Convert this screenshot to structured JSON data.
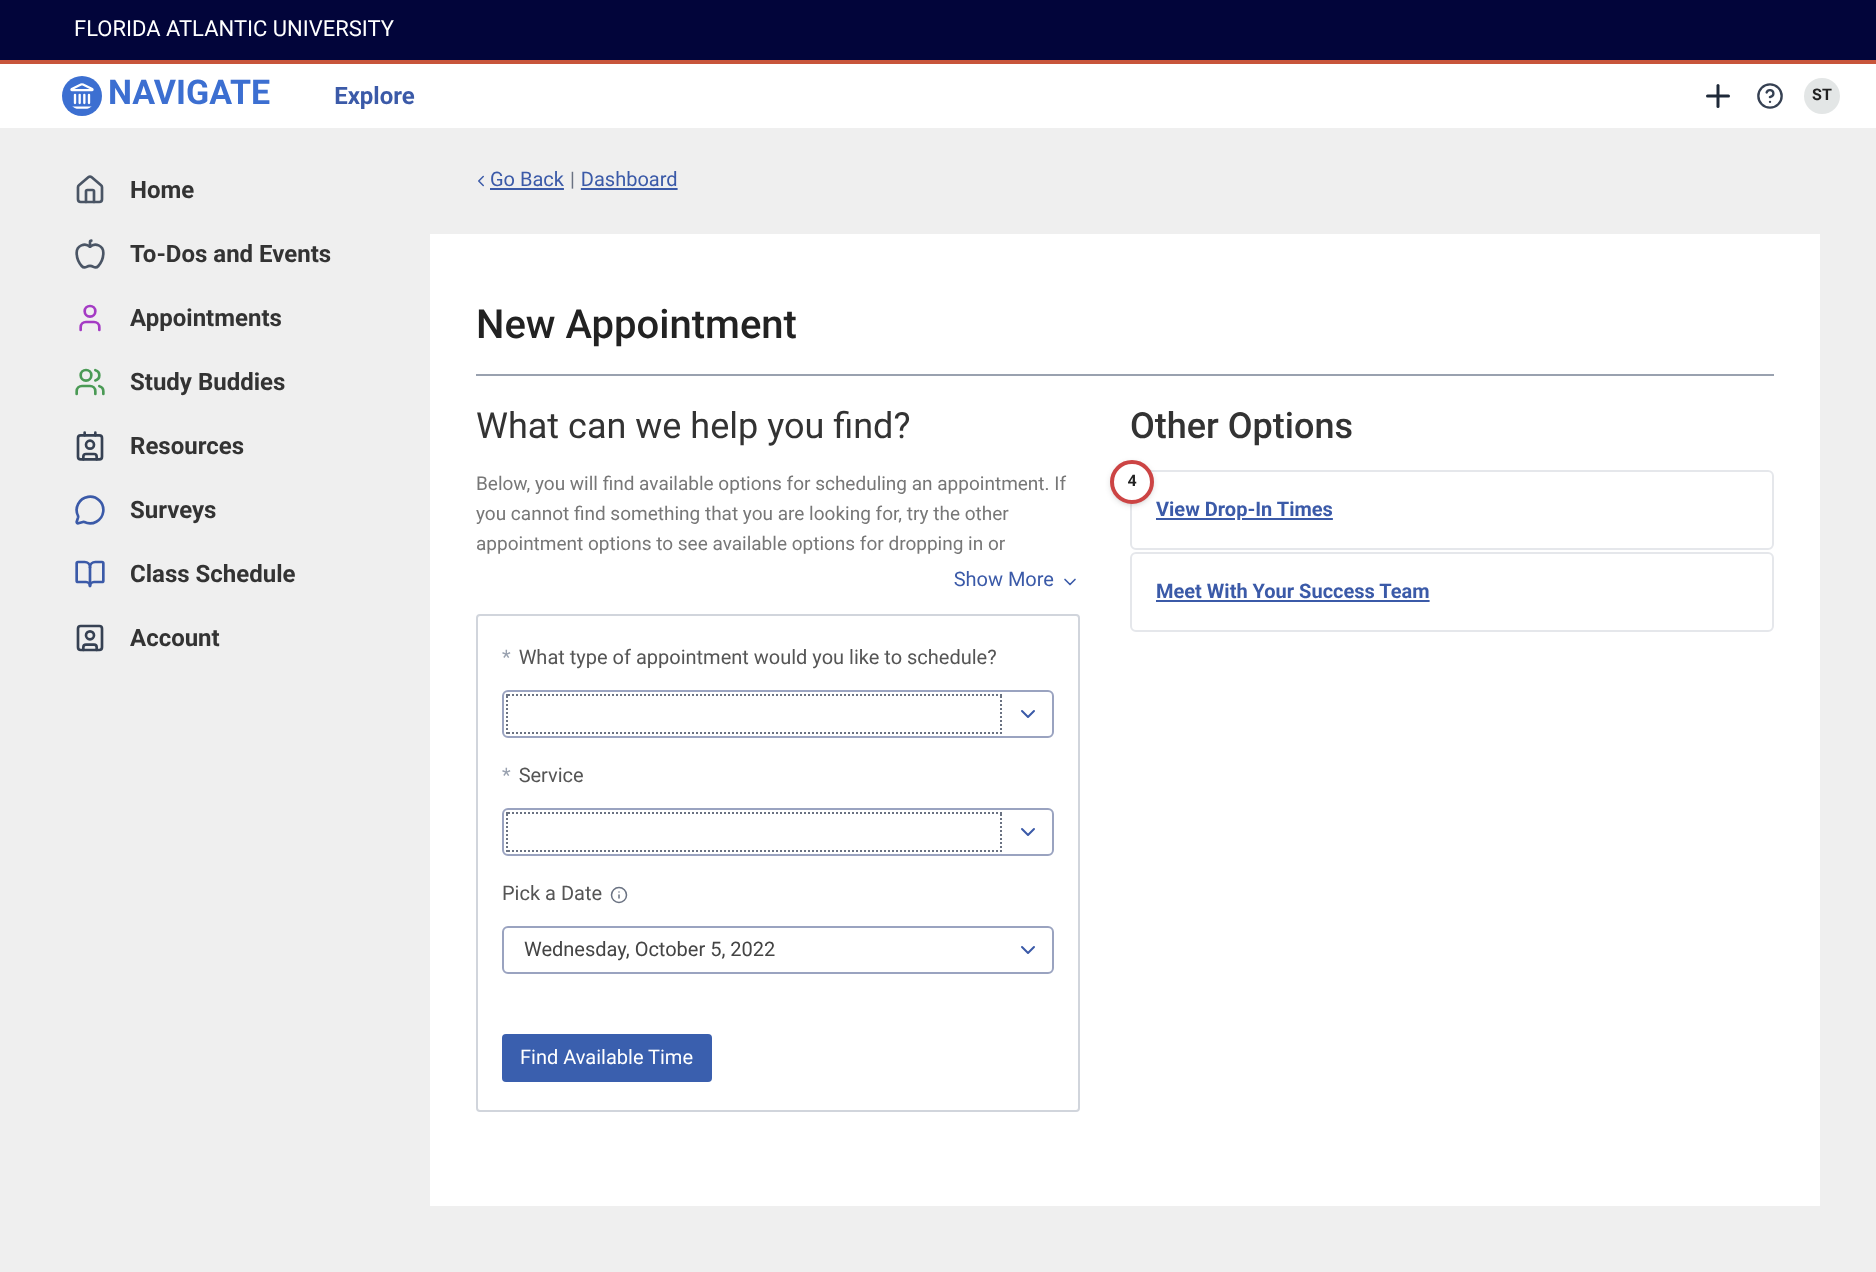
{
  "top_bar": {
    "title": "FLORIDA ATLANTIC UNIVERSITY"
  },
  "header": {
    "brand": "NAVIGATE",
    "nav_link": "Explore",
    "avatar": "ST"
  },
  "sidebar": {
    "items": [
      {
        "label": "Home",
        "selected": false
      },
      {
        "label": "To-Dos and Events",
        "selected": false
      },
      {
        "label": "Appointments",
        "selected": false
      },
      {
        "label": "Study Buddies",
        "selected": false
      },
      {
        "label": "Resources",
        "selected": false
      },
      {
        "label": "Surveys",
        "selected": false
      },
      {
        "label": "Class Schedule",
        "selected": false
      },
      {
        "label": "Account",
        "selected": false
      }
    ]
  },
  "breadcrumb": {
    "back": "Go Back",
    "separator": "|",
    "current": "Dashboard"
  },
  "page_title": "New Appointment",
  "find_section": {
    "heading": "What can we help you find?",
    "description": "Below, you will find available options for scheduling an appointment. If you cannot find something that you are looking for, try the other appointment options to see available options for dropping in or",
    "show_more": "Show More",
    "fields": [
      {
        "label": "What type of appointment would you like to schedule?",
        "required_mark": "*",
        "kind": "dotted"
      },
      {
        "label": "Service",
        "required_mark": "*",
        "kind": "dotted"
      },
      {
        "label": "Pick a Date",
        "kind": "date",
        "value": "Wednesday, October 5, 2022"
      }
    ],
    "submit": "Find Available Time"
  },
  "other_options": {
    "heading": "Other Options",
    "callout": "4",
    "links": [
      "View Drop-In Times",
      "Meet With Your Success Team"
    ]
  }
}
